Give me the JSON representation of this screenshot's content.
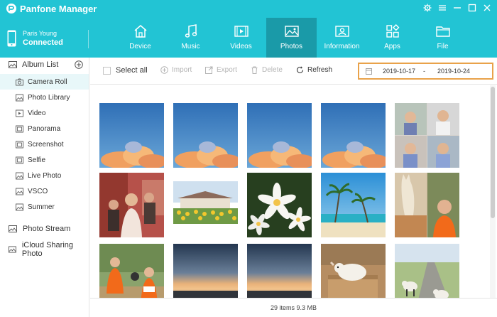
{
  "app": {
    "title": "Panfone Manager",
    "accent_color": "#22c4d4",
    "active_tab_color": "#1a9aa8",
    "window_controls": [
      "gear-icon",
      "menu-icon",
      "minimize-icon",
      "maximize-icon",
      "close-icon"
    ]
  },
  "device": {
    "name": "Paris Young",
    "status": "Connected",
    "icon": "phone-icon"
  },
  "nav": {
    "tabs": [
      {
        "label": "Device",
        "icon": "home-icon"
      },
      {
        "label": "Music",
        "icon": "music-icon"
      },
      {
        "label": "Videos",
        "icon": "video-icon"
      },
      {
        "label": "Photos",
        "icon": "photo-icon",
        "active": true
      },
      {
        "label": "Information",
        "icon": "contact-card-icon"
      },
      {
        "label": "Apps",
        "icon": "apps-icon"
      },
      {
        "label": "File",
        "icon": "folder-icon"
      }
    ]
  },
  "sidebar": {
    "album_header": "Album List",
    "albums": [
      {
        "label": "Camera Roll",
        "icon": "camera-icon",
        "active": true
      },
      {
        "label": "Photo Library",
        "icon": "image-icon"
      },
      {
        "label": "Video",
        "icon": "play-icon"
      },
      {
        "label": "Panorama",
        "icon": "panorama-icon"
      },
      {
        "label": "Screenshot",
        "icon": "screenshot-icon"
      },
      {
        "label": "Selfie",
        "icon": "selfie-icon"
      },
      {
        "label": "Live Photo",
        "icon": "live-photo-icon"
      },
      {
        "label": "VSCO",
        "icon": "image-icon"
      },
      {
        "label": "Summer",
        "icon": "image-icon"
      }
    ],
    "photo_stream": "Photo Stream",
    "icloud_sharing": "iCloud Sharing Photo"
  },
  "toolbar": {
    "select_all": "Select all",
    "import": "Import",
    "export": "Export",
    "delete": "Delete",
    "refresh": "Refresh",
    "date_from": "2019-10-17",
    "date_separator": "-",
    "date_to": "2019-10-24",
    "date_highlight_color": "#e9a24a"
  },
  "photos": [
    {
      "subject": "sky with orange clouds"
    },
    {
      "subject": "sky with orange clouds"
    },
    {
      "subject": "sky with orange clouds"
    },
    {
      "subject": "sky with orange clouds"
    },
    {
      "subject": "people collage"
    },
    {
      "subject": "people in red room"
    },
    {
      "subject": "house with sunflower field"
    },
    {
      "subject": "white frangipani flowers"
    },
    {
      "subject": "tropical beach with palm trees"
    },
    {
      "subject": "alpaca with man in orange"
    },
    {
      "subject": "people in orange shirts outdoors"
    },
    {
      "subject": "sunset over sea"
    },
    {
      "subject": "sunset over sea"
    },
    {
      "subject": "lamb in wooden box"
    },
    {
      "subject": "sheep on road"
    }
  ],
  "status": {
    "summary": "29 items 9.3 MB"
  }
}
